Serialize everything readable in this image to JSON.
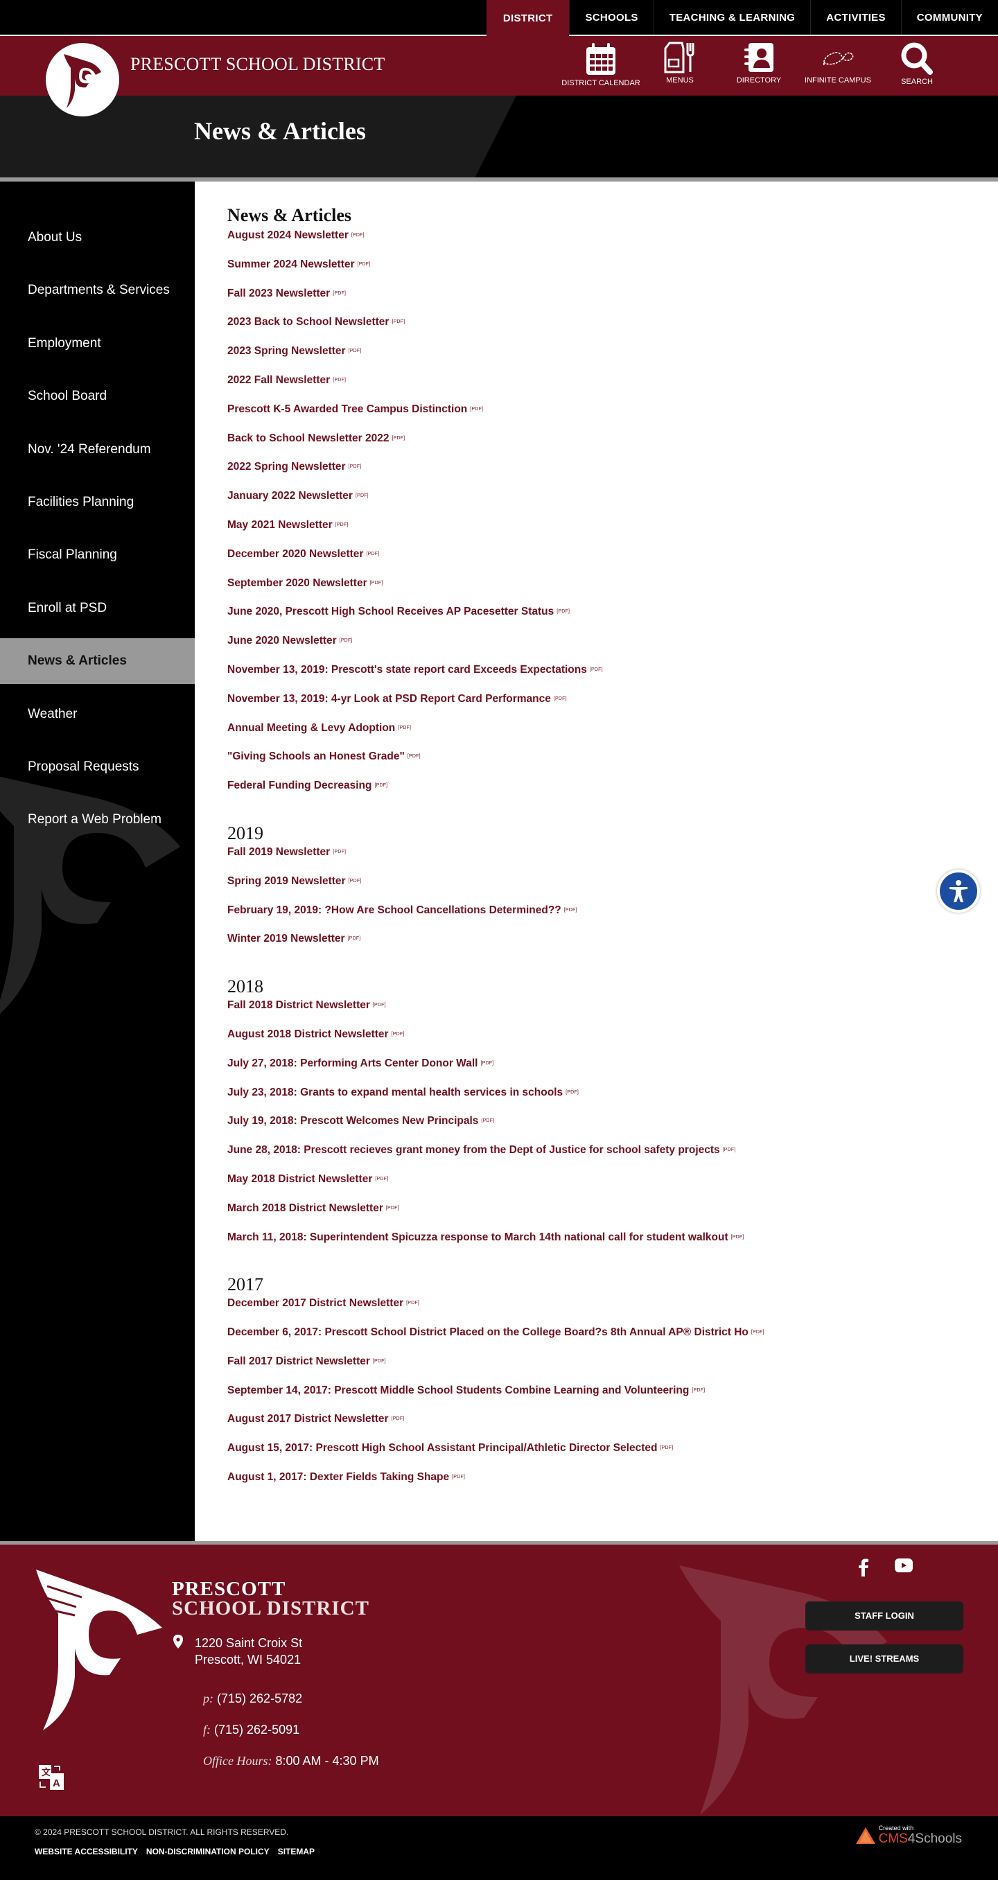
{
  "topnav": {
    "tabs": [
      {
        "label": "DISTRICT",
        "active": true
      },
      {
        "label": "SCHOOLS",
        "active": false
      },
      {
        "label": "TEACHING & LEARNING",
        "active": false
      },
      {
        "label": "ACTIVITIES",
        "active": false
      },
      {
        "label": "COMMUNITY",
        "active": false
      }
    ]
  },
  "brand": {
    "name": "PRESCOTT SCHOOL DISTRICT",
    "quicklinks": [
      {
        "label": "DISTRICT CALENDAR",
        "icon": "calendar-icon"
      },
      {
        "label": "MENUS",
        "icon": "menus-icon"
      },
      {
        "label": "DIRECTORY",
        "icon": "directory-icon"
      },
      {
        "label": "INFINITE CAMPUS",
        "icon": "infinite-campus-icon"
      },
      {
        "label": "SEARCH",
        "icon": "search-icon"
      }
    ]
  },
  "hero": {
    "title": "News & Articles"
  },
  "sidebar": {
    "items": [
      {
        "label": "About Us",
        "active": false
      },
      {
        "label": "Departments & Services",
        "active": false
      },
      {
        "label": "Employment",
        "active": false
      },
      {
        "label": "School Board",
        "active": false
      },
      {
        "label": "Nov. '24 Referendum",
        "active": false
      },
      {
        "label": "Facilities Planning",
        "active": false
      },
      {
        "label": "Fiscal Planning",
        "active": false
      },
      {
        "label": "Enroll at PSD",
        "active": false
      },
      {
        "label": "News & Articles",
        "active": true
      },
      {
        "label": "Weather",
        "active": false
      },
      {
        "label": "Proposal Requests",
        "active": false
      },
      {
        "label": "Report a Web Problem",
        "active": false
      }
    ]
  },
  "content": {
    "pdf_tag": "[PDF]",
    "sections": [
      {
        "heading": "News & Articles",
        "items": [
          "August 2024 Newsletter",
          "Summer 2024 Newsletter",
          "Fall 2023 Newsletter",
          "2023 Back to School Newsletter",
          "2023 Spring Newsletter",
          "2022 Fall Newsletter",
          "Prescott K-5 Awarded Tree Campus Distinction",
          "Back to School Newsletter 2022",
          "2022 Spring Newsletter",
          "January 2022 Newsletter",
          "May 2021 Newsletter",
          "December 2020 Newsletter",
          "September 2020 Newsletter",
          "June 2020, Prescott High School Receives AP Pacesetter Status",
          "June 2020 Newsletter",
          "November 13, 2019: Prescott's state report card Exceeds Expectations",
          "November 13, 2019: 4-yr Look at PSD Report Card Performance",
          "Annual Meeting & Levy Adoption",
          "\"Giving Schools an Honest Grade\"",
          "Federal Funding Decreasing"
        ]
      },
      {
        "heading": "2019",
        "items": [
          "Fall 2019 Newsletter",
          "Spring 2019 Newsletter",
          "February 19, 2019: ?How Are School Cancellations Determined??",
          "Winter 2019 Newsletter"
        ]
      },
      {
        "heading": "2018",
        "items": [
          "Fall 2018 District Newsletter",
          "August 2018 District Newsletter",
          "July 27, 2018: Performing Arts Center Donor Wall",
          "July 23, 2018: Grants to expand mental health services in schools",
          "July 19, 2018: Prescott Welcomes New Principals",
          "June 28, 2018: Prescott recieves grant money from the Dept of Justice for school safety projects",
          "May 2018 District Newsletter",
          "March 2018 District Newsletter",
          "March 11, 2018: Superintendent Spicuzza response to March 14th national call for student walkout"
        ]
      },
      {
        "heading": "2017",
        "items": [
          "December 2017 District Newsletter",
          "December 6, 2017: Prescott School District Placed on the College Board?s 8th Annual AP® District Ho",
          "Fall 2017 District Newsletter",
          "September 14, 2017: Prescott Middle School Students Combine Learning and Volunteering",
          "August 2017 District Newsletter",
          "August 15, 2017: Prescott High School Assistant Principal/Athletic Director Selected",
          "August 1, 2017: Dexter Fields Taking Shape"
        ]
      }
    ]
  },
  "footer": {
    "title_line1": "PRESCOTT",
    "title_line2": "SCHOOL DISTRICT",
    "address_line1": "1220 Saint Croix St",
    "address_line2": "Prescott, WI 54021",
    "phone_label": "p:",
    "phone": "(715) 262-5782",
    "fax_label": "f:",
    "fax": "(715) 262-5091",
    "hours_label": "Office Hours:",
    "hours": "8:00 AM - 4:30 PM",
    "buttons": {
      "staff_login": "STAFF LOGIN",
      "live_streams": "LIVE! STREAMS"
    },
    "social": [
      "facebook-icon",
      "youtube-icon"
    ]
  },
  "bottombar": {
    "copyright": "© 2024 PRESCOTT SCHOOL DISTRICT. ALL RIGHTS RESERVED.",
    "links": [
      "WEBSITE ACCESSIBILITY",
      "NON-DISCRIMINATION POLICY",
      "SITEMAP"
    ],
    "cms_created": "Created with",
    "cms_brand_red": "CMS",
    "cms_brand_rest": "4Schools"
  },
  "colors": {
    "brand_maroon": "#710f1f",
    "accessibility_blue": "#1d4da0",
    "active_sidebar": "#999999"
  }
}
